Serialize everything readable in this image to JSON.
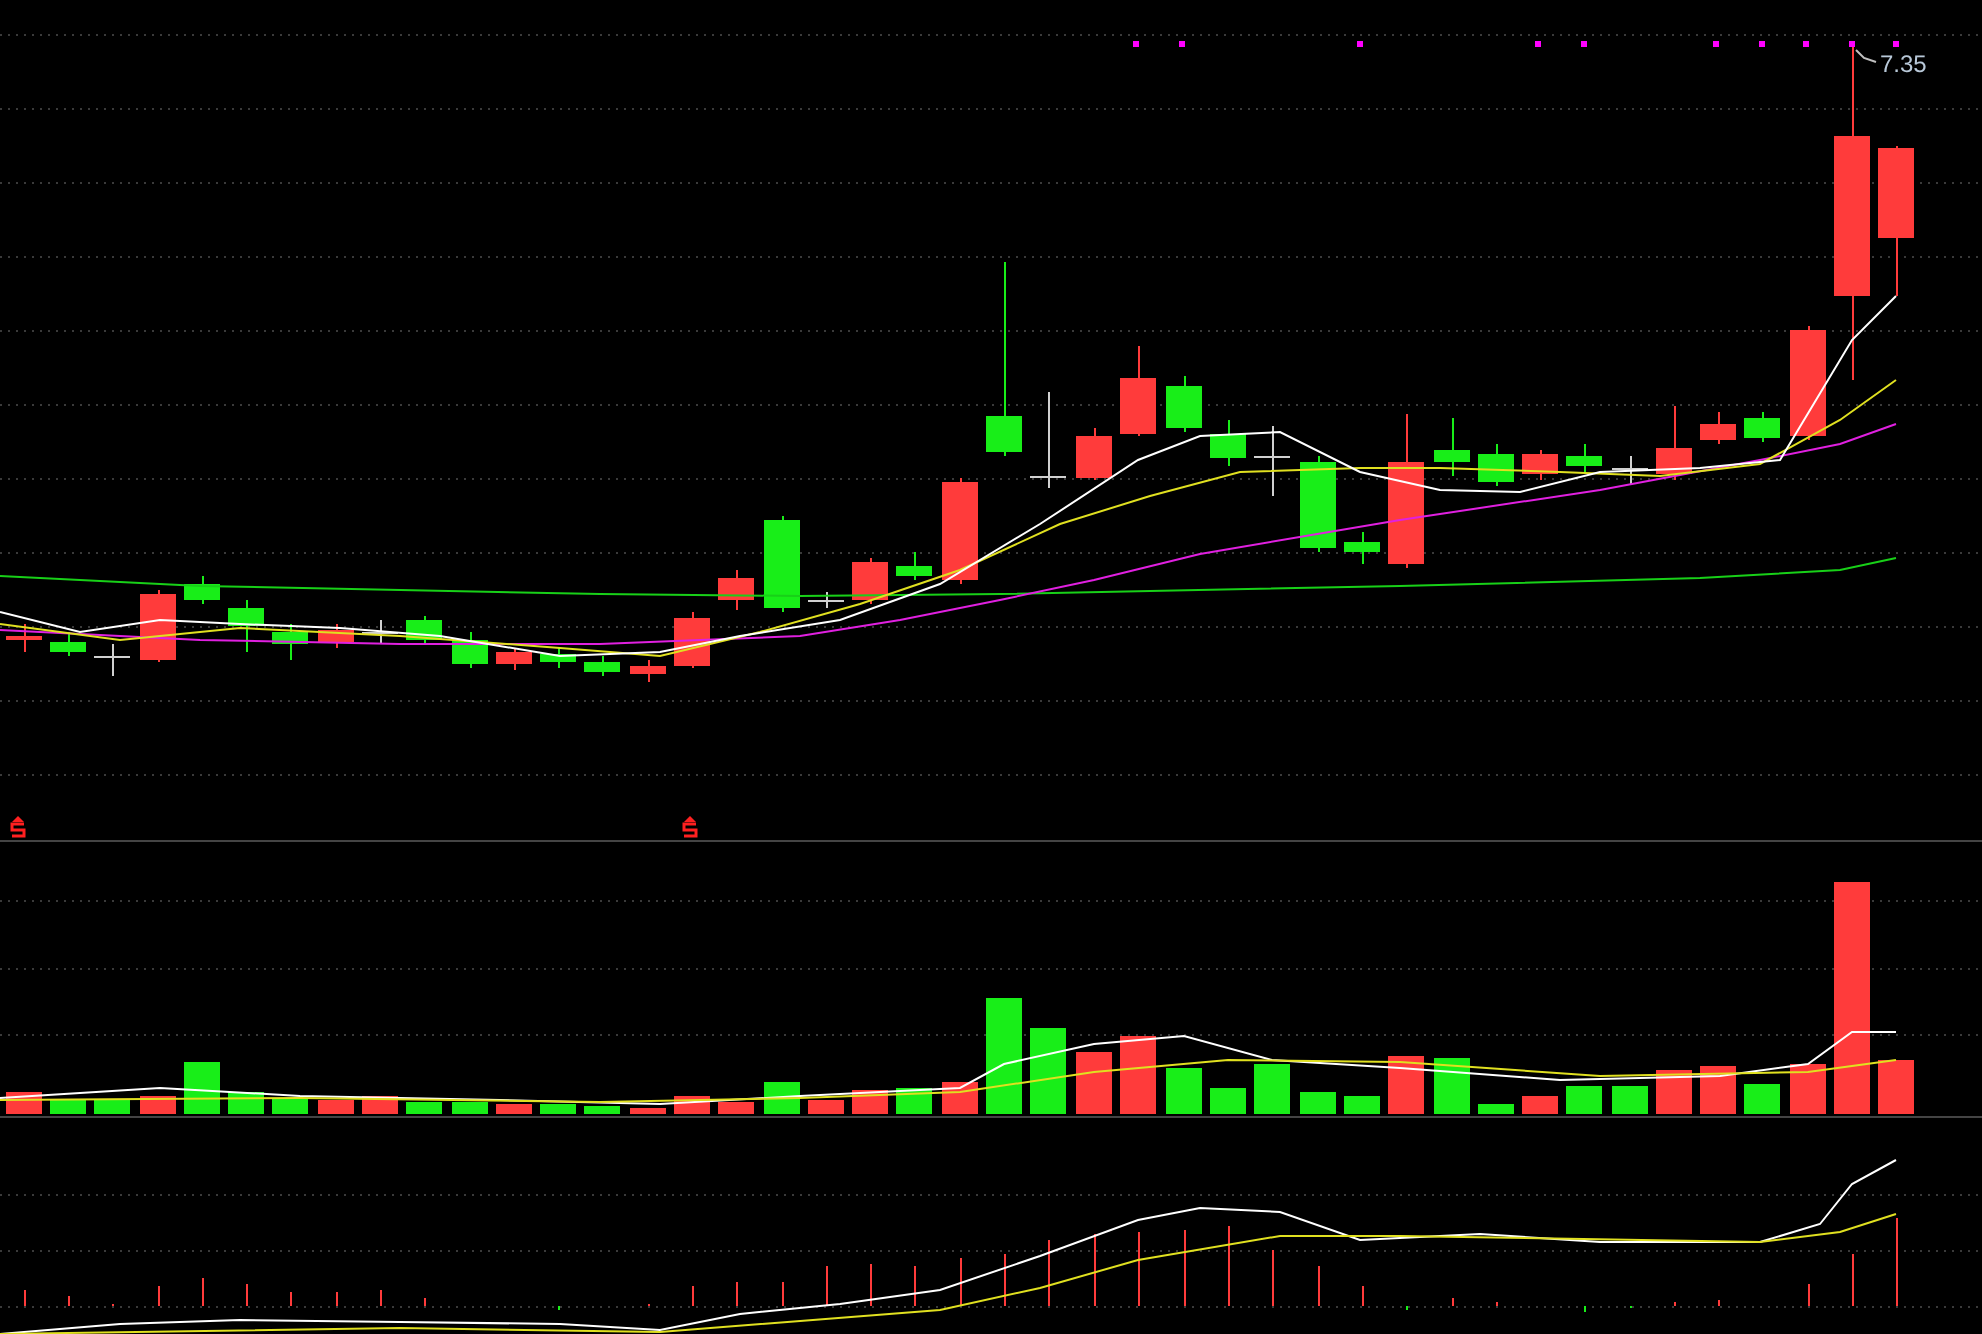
{
  "main_chart": {
    "high_price_label": "7.35"
  }
}
